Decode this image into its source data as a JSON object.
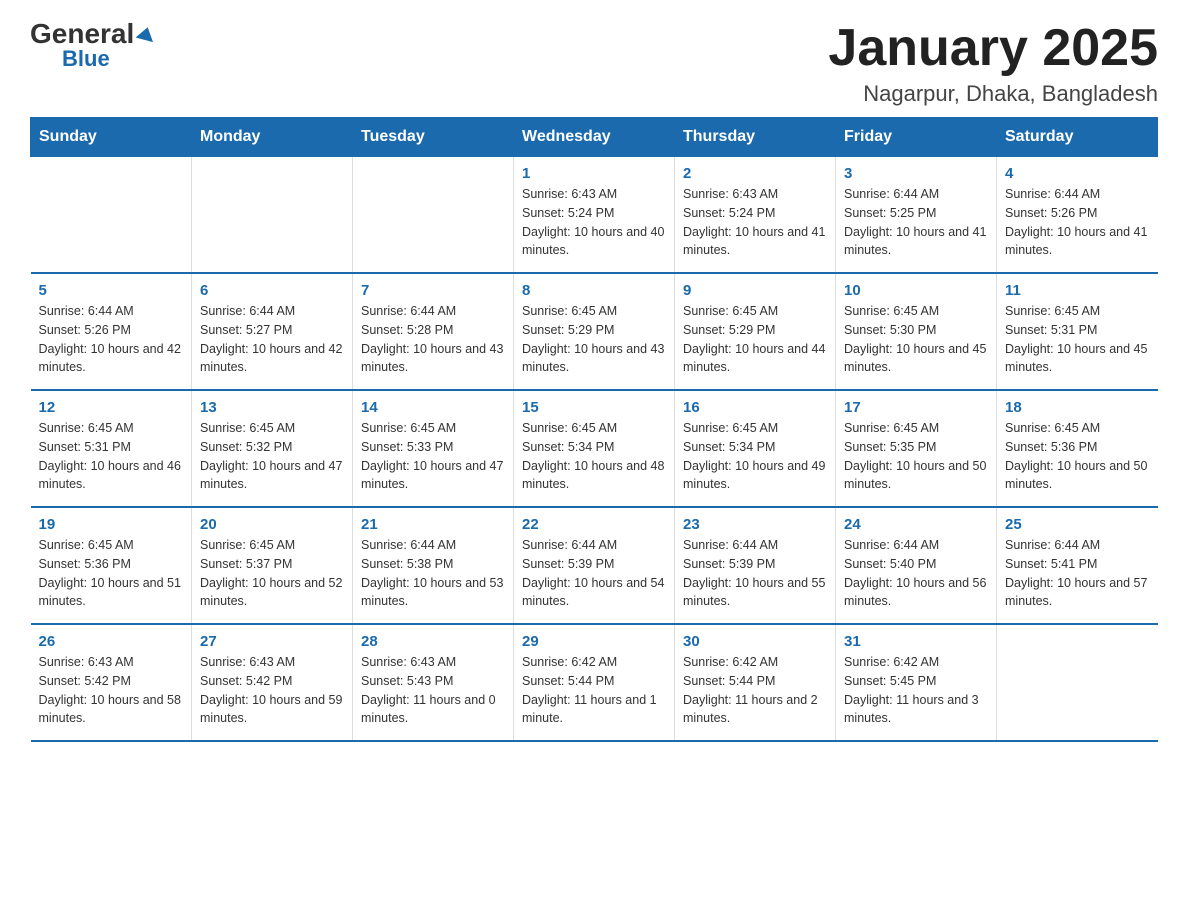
{
  "logo": {
    "general": "General",
    "blue": "Blue",
    "triangle_alt": "triangle decoration"
  },
  "title": "January 2025",
  "subtitle": "Nagarpur, Dhaka, Bangladesh",
  "days_of_week": [
    "Sunday",
    "Monday",
    "Tuesday",
    "Wednesday",
    "Thursday",
    "Friday",
    "Saturday"
  ],
  "weeks": [
    [
      {
        "day": "",
        "info": ""
      },
      {
        "day": "",
        "info": ""
      },
      {
        "day": "",
        "info": ""
      },
      {
        "day": "1",
        "info": "Sunrise: 6:43 AM\nSunset: 5:24 PM\nDaylight: 10 hours and 40 minutes."
      },
      {
        "day": "2",
        "info": "Sunrise: 6:43 AM\nSunset: 5:24 PM\nDaylight: 10 hours and 41 minutes."
      },
      {
        "day": "3",
        "info": "Sunrise: 6:44 AM\nSunset: 5:25 PM\nDaylight: 10 hours and 41 minutes."
      },
      {
        "day": "4",
        "info": "Sunrise: 6:44 AM\nSunset: 5:26 PM\nDaylight: 10 hours and 41 minutes."
      }
    ],
    [
      {
        "day": "5",
        "info": "Sunrise: 6:44 AM\nSunset: 5:26 PM\nDaylight: 10 hours and 42 minutes."
      },
      {
        "day": "6",
        "info": "Sunrise: 6:44 AM\nSunset: 5:27 PM\nDaylight: 10 hours and 42 minutes."
      },
      {
        "day": "7",
        "info": "Sunrise: 6:44 AM\nSunset: 5:28 PM\nDaylight: 10 hours and 43 minutes."
      },
      {
        "day": "8",
        "info": "Sunrise: 6:45 AM\nSunset: 5:29 PM\nDaylight: 10 hours and 43 minutes."
      },
      {
        "day": "9",
        "info": "Sunrise: 6:45 AM\nSunset: 5:29 PM\nDaylight: 10 hours and 44 minutes."
      },
      {
        "day": "10",
        "info": "Sunrise: 6:45 AM\nSunset: 5:30 PM\nDaylight: 10 hours and 45 minutes."
      },
      {
        "day": "11",
        "info": "Sunrise: 6:45 AM\nSunset: 5:31 PM\nDaylight: 10 hours and 45 minutes."
      }
    ],
    [
      {
        "day": "12",
        "info": "Sunrise: 6:45 AM\nSunset: 5:31 PM\nDaylight: 10 hours and 46 minutes."
      },
      {
        "day": "13",
        "info": "Sunrise: 6:45 AM\nSunset: 5:32 PM\nDaylight: 10 hours and 47 minutes."
      },
      {
        "day": "14",
        "info": "Sunrise: 6:45 AM\nSunset: 5:33 PM\nDaylight: 10 hours and 47 minutes."
      },
      {
        "day": "15",
        "info": "Sunrise: 6:45 AM\nSunset: 5:34 PM\nDaylight: 10 hours and 48 minutes."
      },
      {
        "day": "16",
        "info": "Sunrise: 6:45 AM\nSunset: 5:34 PM\nDaylight: 10 hours and 49 minutes."
      },
      {
        "day": "17",
        "info": "Sunrise: 6:45 AM\nSunset: 5:35 PM\nDaylight: 10 hours and 50 minutes."
      },
      {
        "day": "18",
        "info": "Sunrise: 6:45 AM\nSunset: 5:36 PM\nDaylight: 10 hours and 50 minutes."
      }
    ],
    [
      {
        "day": "19",
        "info": "Sunrise: 6:45 AM\nSunset: 5:36 PM\nDaylight: 10 hours and 51 minutes."
      },
      {
        "day": "20",
        "info": "Sunrise: 6:45 AM\nSunset: 5:37 PM\nDaylight: 10 hours and 52 minutes."
      },
      {
        "day": "21",
        "info": "Sunrise: 6:44 AM\nSunset: 5:38 PM\nDaylight: 10 hours and 53 minutes."
      },
      {
        "day": "22",
        "info": "Sunrise: 6:44 AM\nSunset: 5:39 PM\nDaylight: 10 hours and 54 minutes."
      },
      {
        "day": "23",
        "info": "Sunrise: 6:44 AM\nSunset: 5:39 PM\nDaylight: 10 hours and 55 minutes."
      },
      {
        "day": "24",
        "info": "Sunrise: 6:44 AM\nSunset: 5:40 PM\nDaylight: 10 hours and 56 minutes."
      },
      {
        "day": "25",
        "info": "Sunrise: 6:44 AM\nSunset: 5:41 PM\nDaylight: 10 hours and 57 minutes."
      }
    ],
    [
      {
        "day": "26",
        "info": "Sunrise: 6:43 AM\nSunset: 5:42 PM\nDaylight: 10 hours and 58 minutes."
      },
      {
        "day": "27",
        "info": "Sunrise: 6:43 AM\nSunset: 5:42 PM\nDaylight: 10 hours and 59 minutes."
      },
      {
        "day": "28",
        "info": "Sunrise: 6:43 AM\nSunset: 5:43 PM\nDaylight: 11 hours and 0 minutes."
      },
      {
        "day": "29",
        "info": "Sunrise: 6:42 AM\nSunset: 5:44 PM\nDaylight: 11 hours and 1 minute."
      },
      {
        "day": "30",
        "info": "Sunrise: 6:42 AM\nSunset: 5:44 PM\nDaylight: 11 hours and 2 minutes."
      },
      {
        "day": "31",
        "info": "Sunrise: 6:42 AM\nSunset: 5:45 PM\nDaylight: 11 hours and 3 minutes."
      },
      {
        "day": "",
        "info": ""
      }
    ]
  ]
}
